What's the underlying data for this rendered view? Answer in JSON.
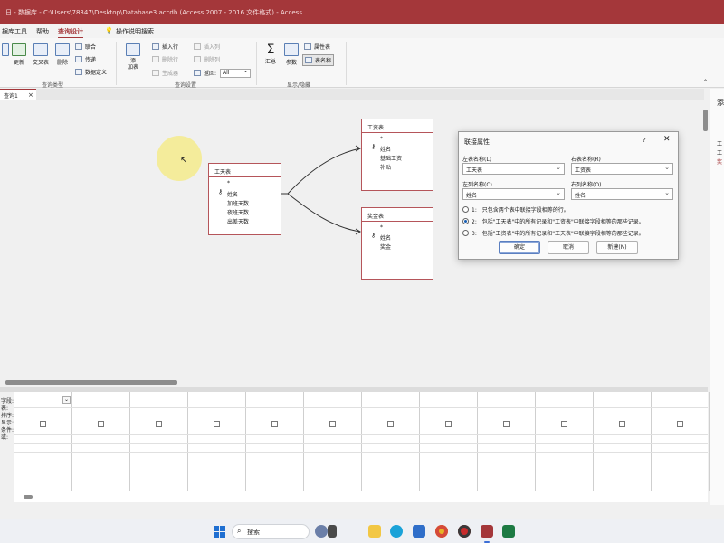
{
  "window": {
    "title": "日 - 数据库 - C:\\Users\\78347\\Desktop\\Database3.accdb (Access 2007 - 2016 文件格式) - Access",
    "accent": "#a4373a"
  },
  "menu": {
    "items": [
      "据库工具",
      "帮助",
      "查询设计"
    ],
    "active": "查询设计",
    "search_label": "操作说明搜索"
  },
  "ribbon": {
    "query_type": {
      "buttons": [
        "更新",
        "交叉表",
        "删除"
      ],
      "side_items": [
        "联合",
        "传递",
        "数据定义"
      ],
      "group_label": "查询类型"
    },
    "query_setup": {
      "add_table": "添\n加表",
      "rows": [
        "插入行",
        "删除行",
        "生成器"
      ],
      "cols": [
        "插入列",
        "删除列"
      ],
      "return_label": "返回:",
      "return_value": "All",
      "group_label": "查询设置"
    },
    "show_hide": {
      "totals": "汇总",
      "params": "参数",
      "property_sheet": "属性表",
      "table_names": "表名称",
      "group_label": "显示/隐藏"
    }
  },
  "document_tab": {
    "label": "查询1",
    "close": "×"
  },
  "tables": [
    {
      "name": "工天表",
      "fields": [
        "*",
        "姓名",
        "加班天数",
        "夜班天数",
        "出差天数"
      ]
    },
    {
      "name": "工资表",
      "fields": [
        "*",
        "姓名",
        "基础工资",
        "补贴"
      ]
    },
    {
      "name": "奖金表",
      "fields": [
        "*",
        "姓名",
        "奖金"
      ]
    }
  ],
  "qbe": {
    "row_labels": [
      "字段:",
      "表:",
      "排序:",
      "显示:",
      "条件:",
      "或:"
    ],
    "show_checkboxes": 12
  },
  "dialog": {
    "title": "联接属性",
    "help": "?",
    "close": "✕",
    "left_table_label": "左表名称(L)",
    "left_table_value": "工天表",
    "right_table_label": "右表名称(R)",
    "right_table_value": "工资表",
    "left_column_label": "左列名称(C)",
    "left_column_value": "姓名",
    "right_column_label": "右列名称(O)",
    "right_column_value": "姓名",
    "options": [
      {
        "key": "1:",
        "text": "只包含两个表中联接字段相等的行。"
      },
      {
        "key": "2:",
        "text": "包括\"工天表\"中的所有记录和\"工资表\"中联接字段相等的那些记录。"
      },
      {
        "key": "3:",
        "text": "包括\"工资表\"中的所有记录和\"工天表\"中联接字段相等的那些记录。"
      }
    ],
    "selected_option": 2,
    "ok_label": "确定",
    "cancel_label": "取消",
    "new_label": "新建(N)"
  },
  "right_pane": {
    "header": "添",
    "items": [
      "工",
      "工",
      "奖"
    ]
  },
  "taskbar": {
    "search_placeholder": "搜索",
    "apps": [
      "widget-app",
      "file-explorer",
      "edge-browser",
      "microsoft-store",
      "chrome-browser",
      "recorder-app",
      "access-app",
      "excel-app"
    ]
  }
}
